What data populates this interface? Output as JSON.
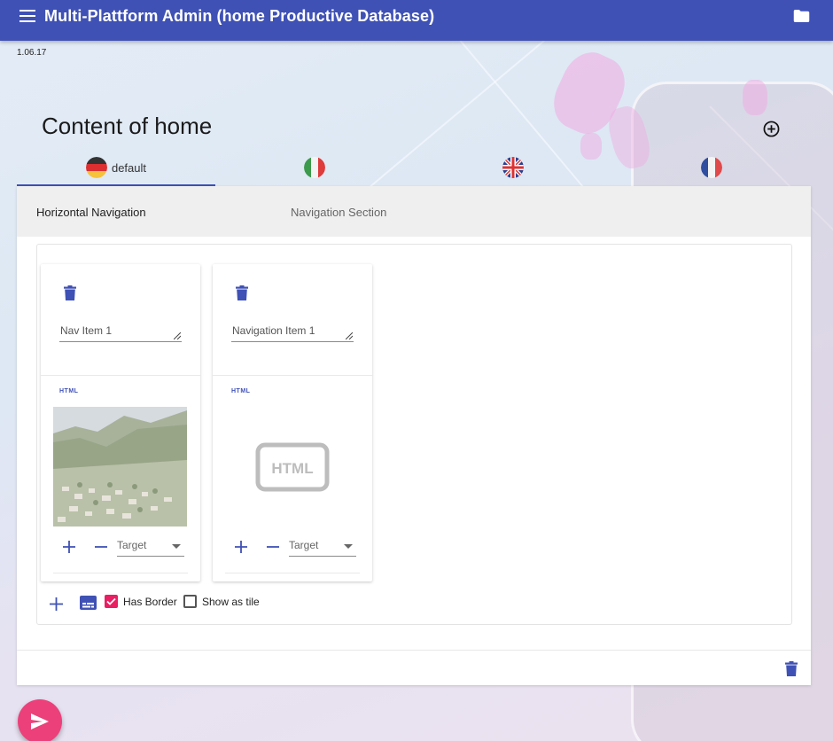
{
  "app": {
    "title": "Multi-Plattform Admin (home Productive Database)",
    "version": "1.06.17"
  },
  "page": {
    "title": "Content of home"
  },
  "languages": [
    {
      "label": "default",
      "flag": "de",
      "active": true
    },
    {
      "label": "",
      "flag": "it",
      "active": false
    },
    {
      "label": "",
      "flag": "gb",
      "active": false
    },
    {
      "label": "",
      "flag": "fr",
      "active": false
    }
  ],
  "section_tabs": [
    {
      "label": "Horizontal Navigation",
      "active": true
    },
    {
      "label": "Navigation Section",
      "active": false
    }
  ],
  "nav_items": [
    {
      "name": "Nav Item 1",
      "badge": "HTML",
      "media": "photo",
      "target_placeholder": "Target"
    },
    {
      "name": "Navigation Item 1",
      "badge": "HTML",
      "media": "html-placeholder",
      "target_placeholder": "Target"
    }
  ],
  "options": {
    "has_border_label": "Has Border",
    "has_border_checked": true,
    "show_as_tile_label": "Show as tile",
    "show_as_tile_checked": false
  },
  "colors": {
    "primary": "#3f51b5",
    "accent": "#e91e63",
    "fab": "#ec407a"
  },
  "icons": [
    "menu-icon",
    "folder-icon",
    "add-circle-icon",
    "trash-icon",
    "plus-icon",
    "minus-icon",
    "subtitles-icon",
    "send-icon",
    "html-icon"
  ]
}
